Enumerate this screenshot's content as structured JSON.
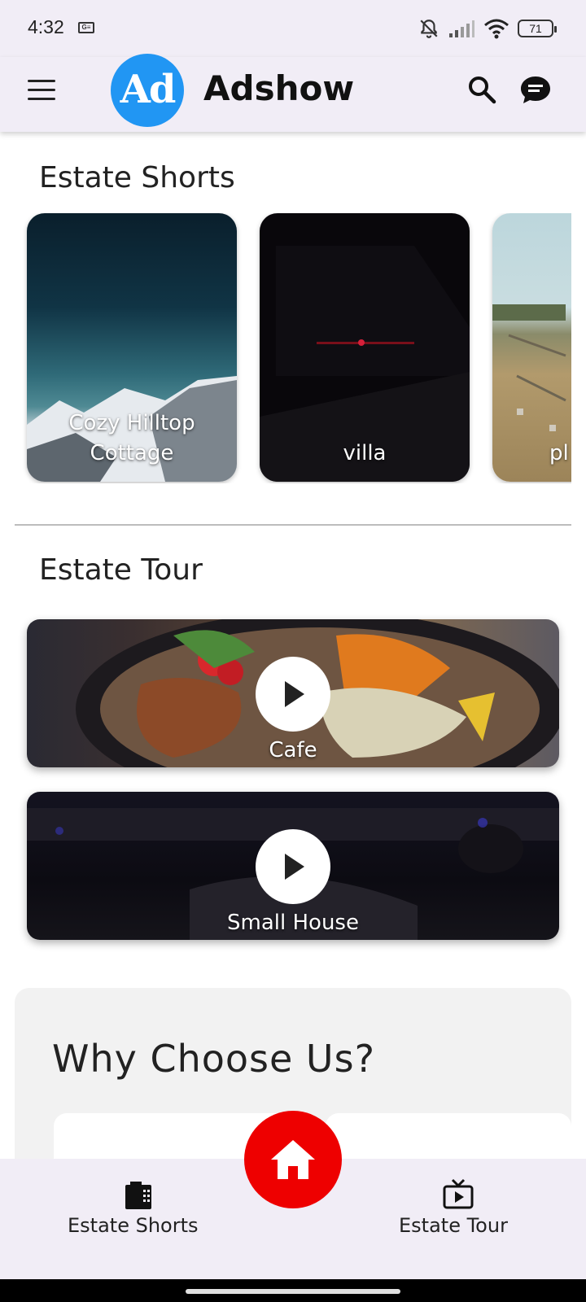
{
  "status_bar": {
    "time": "4:32",
    "sim_label": "G≡",
    "battery": "71",
    "icons": [
      "bell-off-icon",
      "signal-icon",
      "wifi-icon",
      "battery-icon"
    ]
  },
  "app_bar": {
    "logo_text": "Ad",
    "title": "Adshow",
    "icons": [
      "menu-icon",
      "search-icon",
      "chat-icon"
    ]
  },
  "shorts": {
    "title": "Estate Shorts",
    "items": [
      {
        "label": "Cozy Hilltop Cottage"
      },
      {
        "label": "villa"
      },
      {
        "label": "pl"
      }
    ]
  },
  "tour": {
    "title": "Estate Tour",
    "items": [
      {
        "label": "Cafe"
      },
      {
        "label": "Small House"
      }
    ]
  },
  "why": {
    "title": "Why Choose Us?"
  },
  "bottom_nav": {
    "left_label": "Estate Shorts",
    "right_label": "Estate Tour",
    "icons": [
      "film-icon",
      "home-icon",
      "tv-icon"
    ]
  },
  "colors": {
    "bar_background": "#f1edf6",
    "logo_blue": "#2196f3",
    "fab_red": "#ee0000"
  }
}
